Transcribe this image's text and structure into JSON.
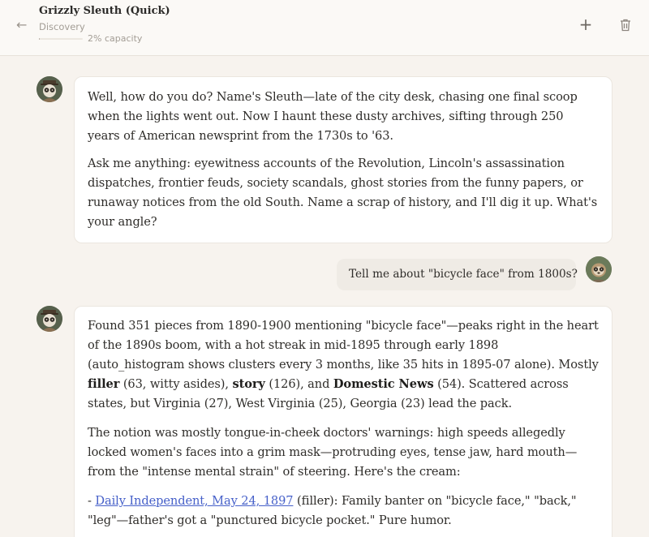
{
  "header": {
    "title": "Grizzly Sleuth (Quick)",
    "subtitle": "Discovery",
    "capacity_label": "2% capacity",
    "capacity_fraction": 0.02,
    "back_icon": "arrow-left-icon",
    "new_icon": "plus-icon",
    "delete_icon": "trash-icon"
  },
  "messages": {
    "bot1": {
      "p1": "Well, how do you do? Name's Sleuth—late of the city desk, chasing one final scoop when the lights went out. Now I haunt these dusty archives, sifting through 250 years of American newsprint from the 1730s to '63.",
      "p2": "Ask me anything: eyewitness accounts of the Revolution, Lincoln's assassination dispatches, frontier feuds, society scandals, ghost stories from the funny papers, or runaway notices from the old South. Name a scrap of history, and I'll dig it up. What's your angle?"
    },
    "user1": {
      "text": "Tell me about \"bicycle face\" from 1800s?"
    },
    "bot2": {
      "p1_a": "Found 351 pieces from 1890-1900 mentioning \"bicycle face\"—peaks right in the heart of the 1890s boom, with a hot streak in mid-1895 through early 1898 (auto_histogram shows clusters every 3 months, like 35 hits in 1895-07 alone). Mostly ",
      "p1_b1": "filler",
      "p1_c": " (63, witty asides), ",
      "p1_b2": "story",
      "p1_d": " (126), and ",
      "p1_b3": "Domestic News",
      "p1_e": " (54). Scattered across states, but Virginia (27), West Virginia (25), Georgia (23) lead the pack.",
      "p2": "The notion was mostly tongue-in-cheek doctors' warnings: high speeds allegedly locked women's faces into a grim mask—protruding eyes, tense jaw, hard mouth—from the \"intense mental strain\" of steering. Here's the cream:",
      "p3_prefix": "- ",
      "p3_link": "Daily Independent, May 24, 1897",
      "p3_rest": " (filler): Family banter on \"bicycle face,\" \"back,\" \"leg\"—father's got a \"punctured bicycle pocket.\" Pure humor."
    }
  }
}
